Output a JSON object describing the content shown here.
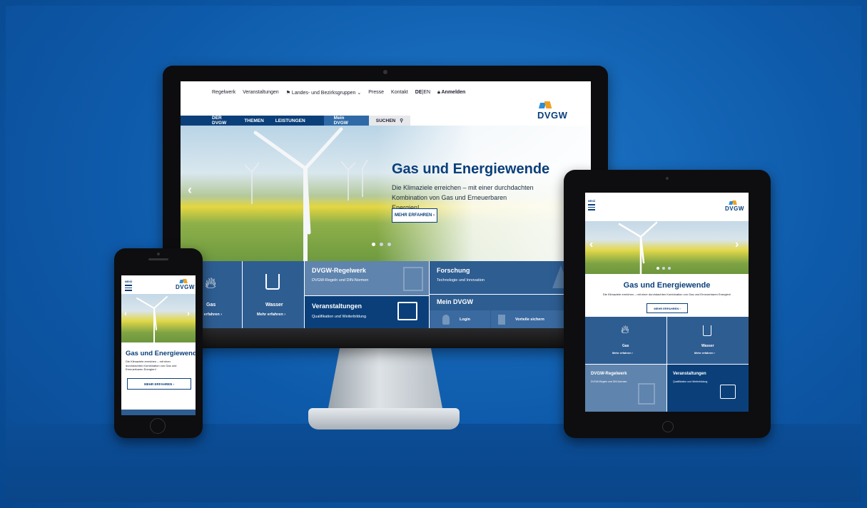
{
  "brand": {
    "logo": "DVGW",
    "primary": "#0a3f7a",
    "accent_blue": "#2d8ed8",
    "accent_orange": "#f0a020"
  },
  "desktop": {
    "topnav": [
      "Regelwerk",
      "Veranstaltungen",
      "Landes- und Bezirksgruppen",
      "Presse",
      "Kontakt",
      "DE",
      "|EN",
      "Anmelden"
    ],
    "mainnav": [
      "DER DVGW",
      "THEMEN",
      "LEISTUNGEN"
    ],
    "mein": "Mein DVGW",
    "search": "SUCHEN",
    "hero_title": "Gas und Energiewende",
    "hero_text": "Die Klimaziele erreichen – mit einer durchdachten Kombination von Gas und Erneuerbaren Energien!",
    "hero_button": "MEHR ERFAHREN",
    "tiles": {
      "gas": "Gas",
      "gas_link": "Mehr erfahren",
      "wasser": "Wasser",
      "wasser_link": "Mehr erfahren",
      "regelwerk": "DVGW-Regelwerk",
      "regelwerk_sub": "DVGW-Regeln und DIN-Normen",
      "forschung": "Forschung",
      "forschung_sub": "Technologie und Innovation",
      "veranstaltungen": "Veranstaltungen",
      "veranstaltungen_sub": "Qualifikation und Weiterbildung",
      "mein": "Mein DVGW",
      "login": "Login",
      "vorteile": "Vorteile sichern"
    }
  },
  "tablet": {
    "menu": "MENÜ",
    "hero_title": "Gas und Energiewende",
    "hero_text": "Die Klimaziele erreichen – mit einer durchdachten Kombination von Gas und Erneuerbaren Energien!",
    "button": "MEHR ERFAHREN",
    "gas": "Gas",
    "gas_link": "Mehr erfahren",
    "wasser": "Wasser",
    "wasser_link": "Mehr erfahren",
    "regelwerk": "DVGW-Regelwerk",
    "regelwerk_sub": "DVGW-Regeln und DIN-Normen",
    "veranstaltungen": "Veranstaltungen",
    "veranstaltungen_sub": "Qualifikation und Weiterbildung"
  },
  "phone": {
    "menu": "MENÜ",
    "hero_title": "Gas und Energiewende",
    "hero_text": "Die Klimaziele erreichen – mit einer durchdachten Kombination von Gas und Erneuerbaren Energien!",
    "button": "MEHR ERFAHREN"
  }
}
